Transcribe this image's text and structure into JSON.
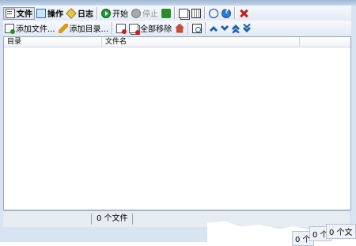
{
  "toolbar1": {
    "file": "文件",
    "operation": "操作",
    "log": "日志",
    "start": "开始",
    "stop": "停止"
  },
  "toolbar2": {
    "add_file": "添加文件...",
    "add_dir": "添加目录...",
    "remove_all": "全部移除"
  },
  "list": {
    "columns": [
      "目录",
      "文件名",
      ""
    ]
  },
  "statusbar": {
    "file_count": "0 个文件"
  },
  "tear_fragments": [
    "0 个",
    "0 个",
    "0 个文"
  ],
  "colors": {
    "toolbar_bg": "#e4ebf5",
    "window_bg": "#d9e4f2",
    "start_green": "#1e9a36",
    "close_red": "#c81d1d",
    "nav_blue": "#1b5fa8"
  },
  "icons": [
    "file-icon",
    "operation-icon",
    "log-icon",
    "start-icon",
    "stop-icon",
    "refresh-icon",
    "copy-icon",
    "grid-icon",
    "speech-icon",
    "help-icon",
    "close-icon",
    "add-file-icon",
    "add-folder-icon",
    "remove-icon",
    "remove-all-icon",
    "home-icon",
    "search-icon",
    "move-up-icon",
    "move-down-icon",
    "move-top-icon",
    "move-bottom-icon"
  ]
}
